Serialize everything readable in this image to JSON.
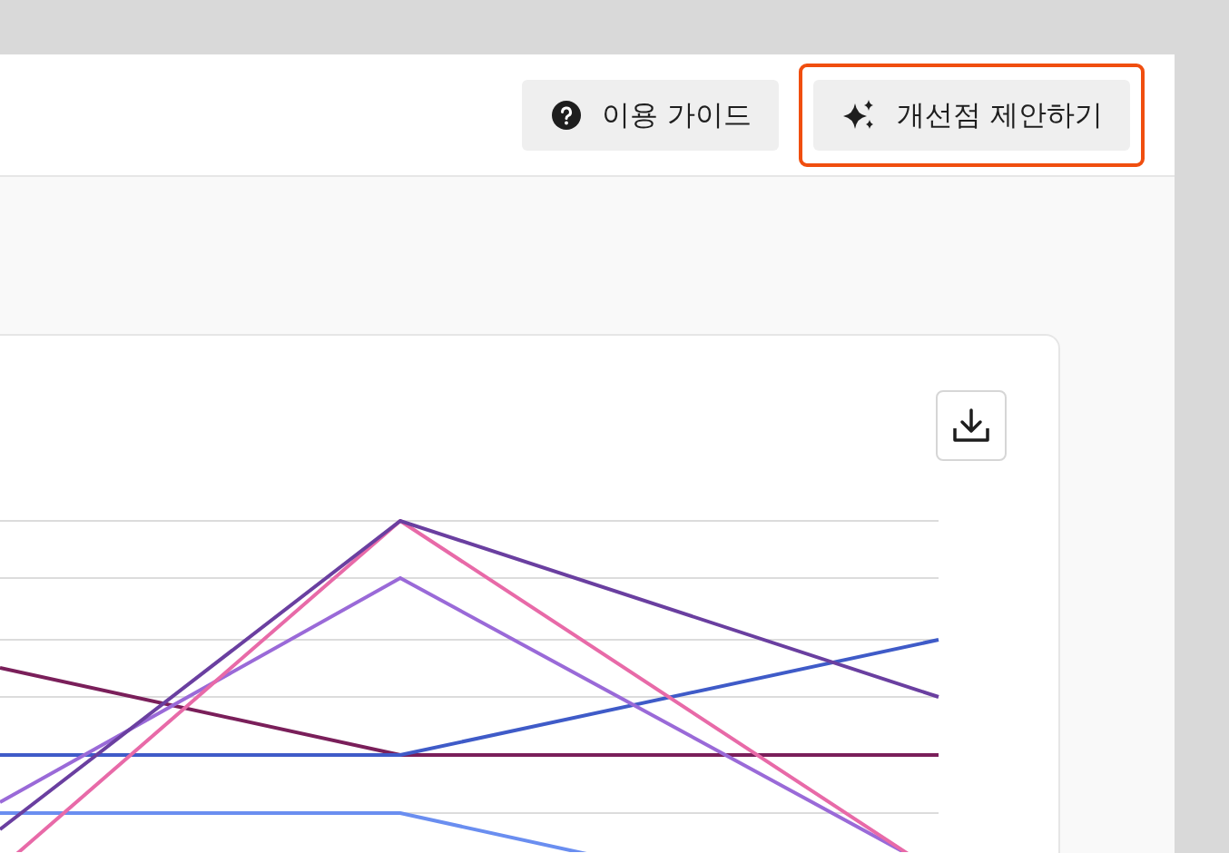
{
  "header": {
    "buttons": [
      {
        "kind": "guide",
        "label": "이용 가이드",
        "highlighted": false
      },
      {
        "kind": "suggest",
        "label": "개선점 제안하기",
        "highlighted": true
      }
    ]
  }
}
